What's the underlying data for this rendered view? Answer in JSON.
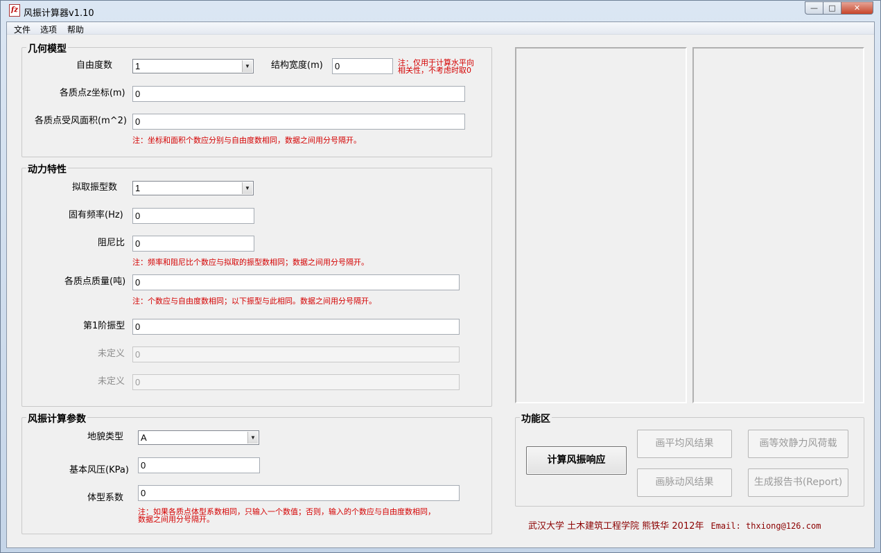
{
  "window": {
    "title": "风振计算器v1.10",
    "icon_text": "fz",
    "buttons": [
      "—",
      "□",
      "✕"
    ]
  },
  "menu": [
    "文件",
    "选项",
    "帮助"
  ],
  "geometry": {
    "title": "几何模型",
    "dof_label": "自由度数",
    "dof_value": "1",
    "width_label": "结构宽度(m)",
    "width_value": "0",
    "width_note_1": "注：仅用于计算水平向",
    "width_note_2": "相关性，不考虑时取0",
    "z_label": "各质点z坐标(m)",
    "z_value": "0",
    "area_label": "各质点受风面积(m^2)",
    "area_value": "0",
    "note": "注：坐标和面积个数应分别与自由度数相同，数据之间用分号隔开。"
  },
  "dynamics": {
    "title": "动力特性",
    "modes_label": "拟取振型数",
    "modes_value": "1",
    "freq_label": "固有频率(Hz)",
    "freq_value": "0",
    "damp_label": "阻尼比",
    "damp_value": "0",
    "note1": "注：频率和阻尼比个数应与拟取的振型数相同；数据之间用分号隔开。",
    "mass_label": "各质点质量(吨)",
    "mass_value": "0",
    "note2": "注：个数应与自由度数相同；以下振型与此相同。数据之间用分号隔开。",
    "mode1_label": "第1阶振型",
    "mode1_value": "0",
    "undef1_label": "未定义",
    "undef1_value": "0",
    "undef2_label": "未定义",
    "undef2_value": "0"
  },
  "wind": {
    "title": "风振计算参数",
    "terrain_label": "地貌类型",
    "terrain_value": "A",
    "pressure_label": "基本风压(KPa)",
    "pressure_value": "0",
    "shape_label": "体型系数",
    "shape_value": "0",
    "note_1": "注：如果各质点体型系数相同，只输入一个数值；否则，输入的个数应与自由度数相同，",
    "note_2": "数据之间用分号隔开。"
  },
  "functions": {
    "title": "功能区",
    "calc": "计算风振响应",
    "plot_mean": "画平均风结果",
    "plot_static": "画等效静力风荷载",
    "plot_fluct": "画脉动风结果",
    "report": "生成报告书(Report)"
  },
  "footer": {
    "credit": "武汉大学 土木建筑工程学院 熊铁华 2012年",
    "email": "Email: thxiong@126.com"
  }
}
